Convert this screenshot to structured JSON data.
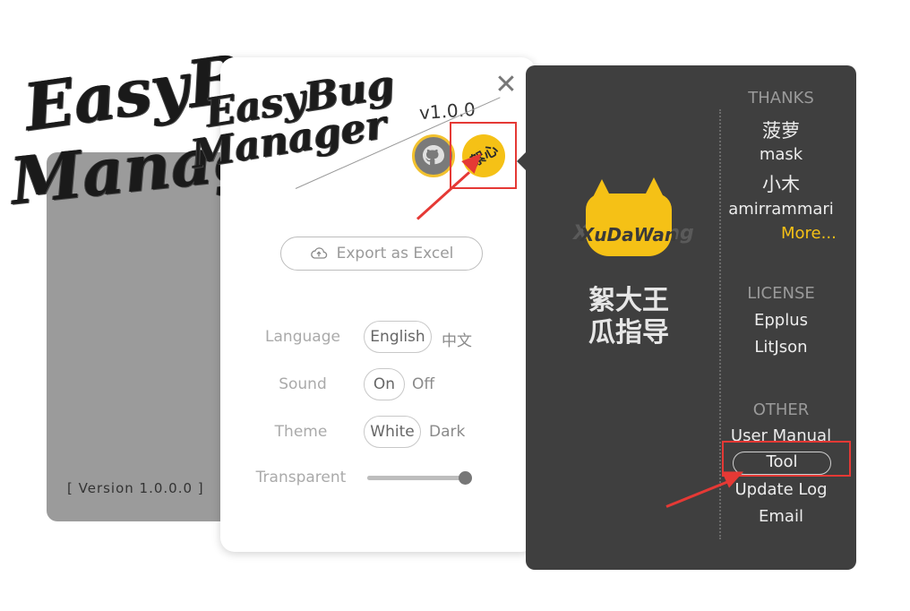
{
  "back_card": {
    "title_line_1": "EasyB",
    "title_line_2": "Manag",
    "version": "[ Version 1.0.0.0 ]"
  },
  "front_card": {
    "title_line_1": "EasyBug",
    "title_line_2": "Manager",
    "version_tag": "v1.0.0",
    "close_symbol": "✕",
    "github_icon": "github-cat-icon",
    "sponsor_label": "絮心",
    "export_label": "Export as Excel",
    "export_icon": "cloud-upload-icon",
    "settings": {
      "language_label": "Language",
      "language_selected": "English",
      "language_alt": "中文",
      "sound_label": "Sound",
      "sound_selected": "On",
      "sound_alt": "Off",
      "theme_label": "Theme",
      "theme_selected": "White",
      "theme_alt": "Dark",
      "transparent_label": "Transparent",
      "transparent_value": 1.0
    }
  },
  "dark_panel": {
    "mascot_watermark": "XuDaWang",
    "mascot_name": "XuDaWan",
    "author_name_line_1": "絮大王",
    "author_name_line_2": "瓜指导",
    "thanks": {
      "heading": "THANKS",
      "items": [
        "菠萝",
        "mask",
        "小木",
        "amirrammari"
      ],
      "more": "More..."
    },
    "license": {
      "heading": "LICENSE",
      "items": [
        "Epplus",
        "LitJson"
      ]
    },
    "other": {
      "heading": "OTHER",
      "items": [
        "User Manual",
        "Tool",
        "Update Log",
        "Email"
      ]
    }
  },
  "colors": {
    "accent": "#f5c116",
    "dark_panel": "#3f3f3f",
    "highlight": "#e53935",
    "back_card": "#9b9b9b"
  }
}
